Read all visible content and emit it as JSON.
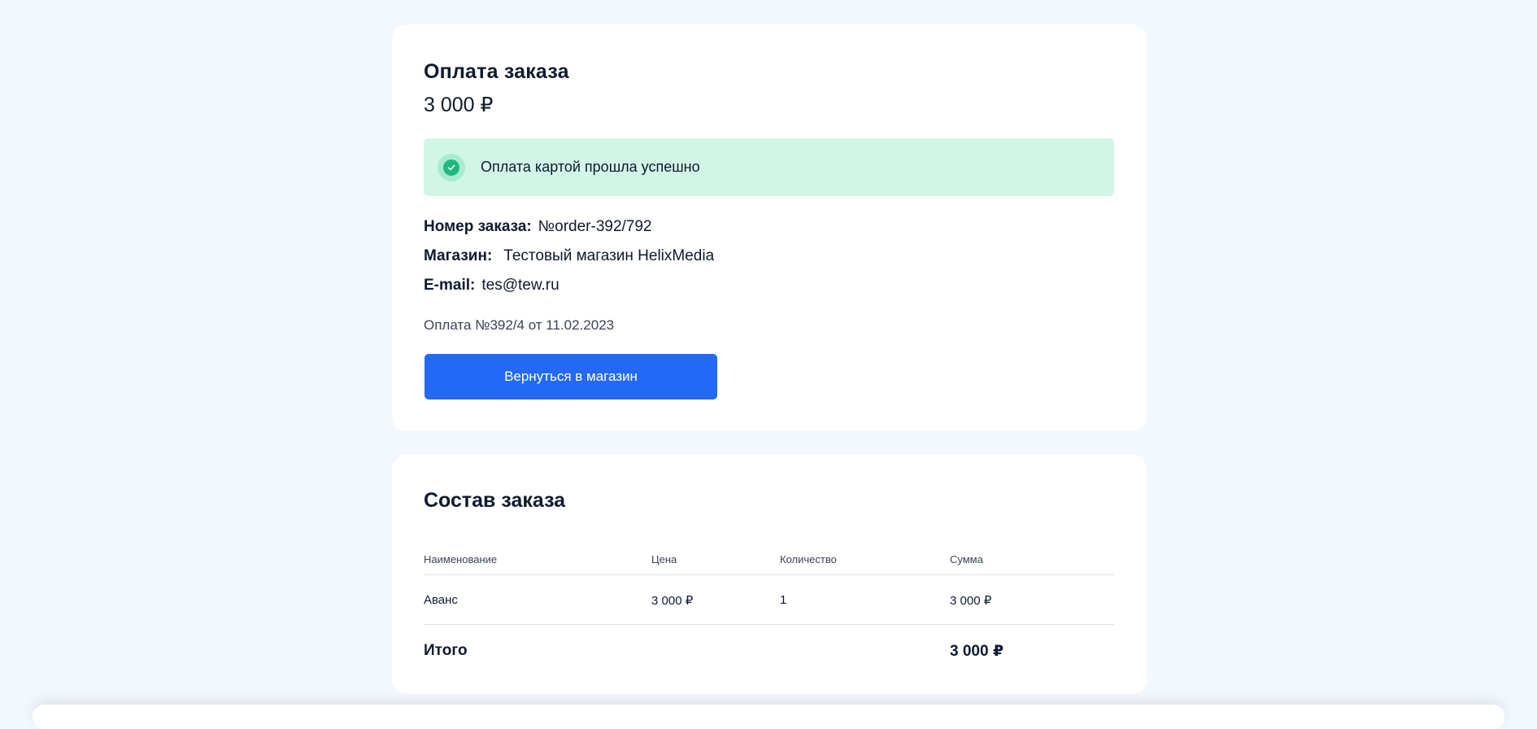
{
  "payment": {
    "title": "Оплата заказа",
    "amount": "3 000 ₽",
    "success_message": "Оплата картой прошла успешно",
    "order_number_label": "Номер заказа:",
    "order_number_value": "№order-392/792",
    "shop_label": "Магазин:",
    "shop_value": "Тестовый магазин HelixMedia",
    "email_label": "E-mail:",
    "email_value": "tes@tew.ru",
    "payment_meta": "Оплата №392/4 от 11.02.2023",
    "back_button_label": "Вернуться в магазин"
  },
  "order": {
    "title": "Состав заказа",
    "columns": [
      "Наименование",
      "Цена",
      "Количество",
      "Сумма"
    ],
    "rows": [
      {
        "name": "Аванс",
        "price": "3 000 ₽",
        "qty": "1",
        "sum": "3 000 ₽"
      }
    ],
    "total_label": "Итого",
    "total_value": "3 000 ₽"
  },
  "colors": {
    "background": "#f3f7fe",
    "card": "#ffffff",
    "success_bg": "#d1f6e6",
    "success_icon": "#1fb97f",
    "primary_button": "#2469f5",
    "text": "#0f1a2e"
  },
  "icons": {
    "success": "check-circle-icon"
  }
}
